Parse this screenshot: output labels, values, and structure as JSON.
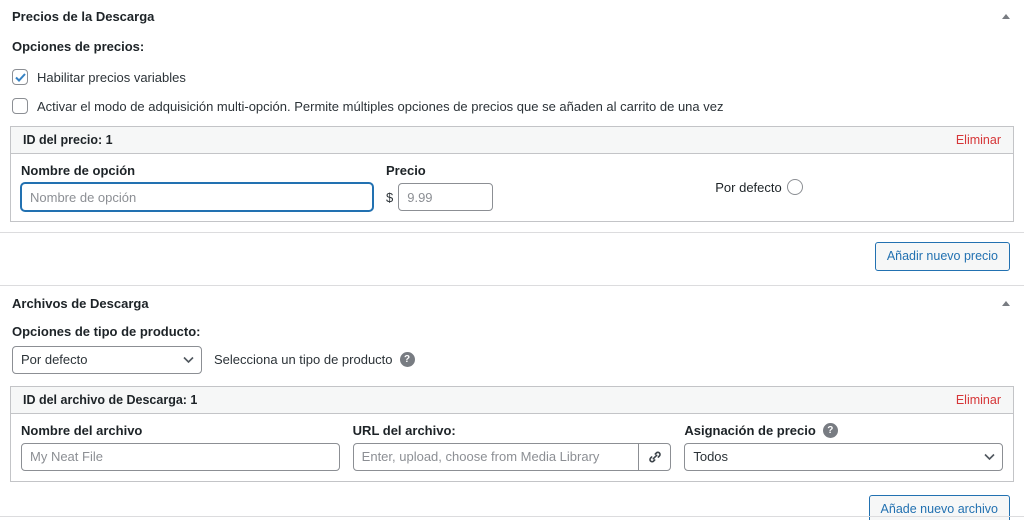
{
  "colors": {
    "accent_blue": "#2271b1",
    "delete_red": "#d63638",
    "row_header_bg": "#f6f7f7",
    "border_gray": "#c3c4c7",
    "placeholder_gray": "#8c8f94"
  },
  "pricing_section": {
    "title": "Precios de la Descarga",
    "options_label": "Opciones de precios:",
    "checkboxes": [
      {
        "label": "Habilitar precios variables",
        "checked": true
      },
      {
        "label": "Activar el modo de adquisición multi-opción. Permite múltiples opciones de precios que se añaden al carrito de una vez",
        "checked": false
      }
    ],
    "price_row": {
      "id_label": "ID del precio: 1",
      "remove_label": "Eliminar",
      "option_name_label": "Nombre de opción",
      "option_name_placeholder": "Nombre de opción",
      "price_label": "Precio",
      "currency_symbol": "$",
      "price_placeholder": "9.99",
      "default_label": "Por defecto"
    },
    "add_button_label": "Añadir nuevo precio"
  },
  "files_section": {
    "title": "Archivos de Descarga",
    "product_type_label": "Opciones de tipo de producto:",
    "product_type_value": "Por defecto",
    "product_type_hint": "Selecciona un tipo de producto",
    "help_glyph": "?",
    "file_row": {
      "id_label": "ID del archivo de Descarga: 1",
      "remove_label": "Eliminar",
      "file_name_label": "Nombre del archivo",
      "file_name_placeholder": "My Neat File",
      "file_url_label": "URL del archivo:",
      "file_url_placeholder": "Enter, upload, choose from Media Library",
      "price_assignment_label": "Asignación de precio",
      "price_assignment_value": "Todos"
    },
    "add_button_label": "Añade nuevo archivo"
  }
}
